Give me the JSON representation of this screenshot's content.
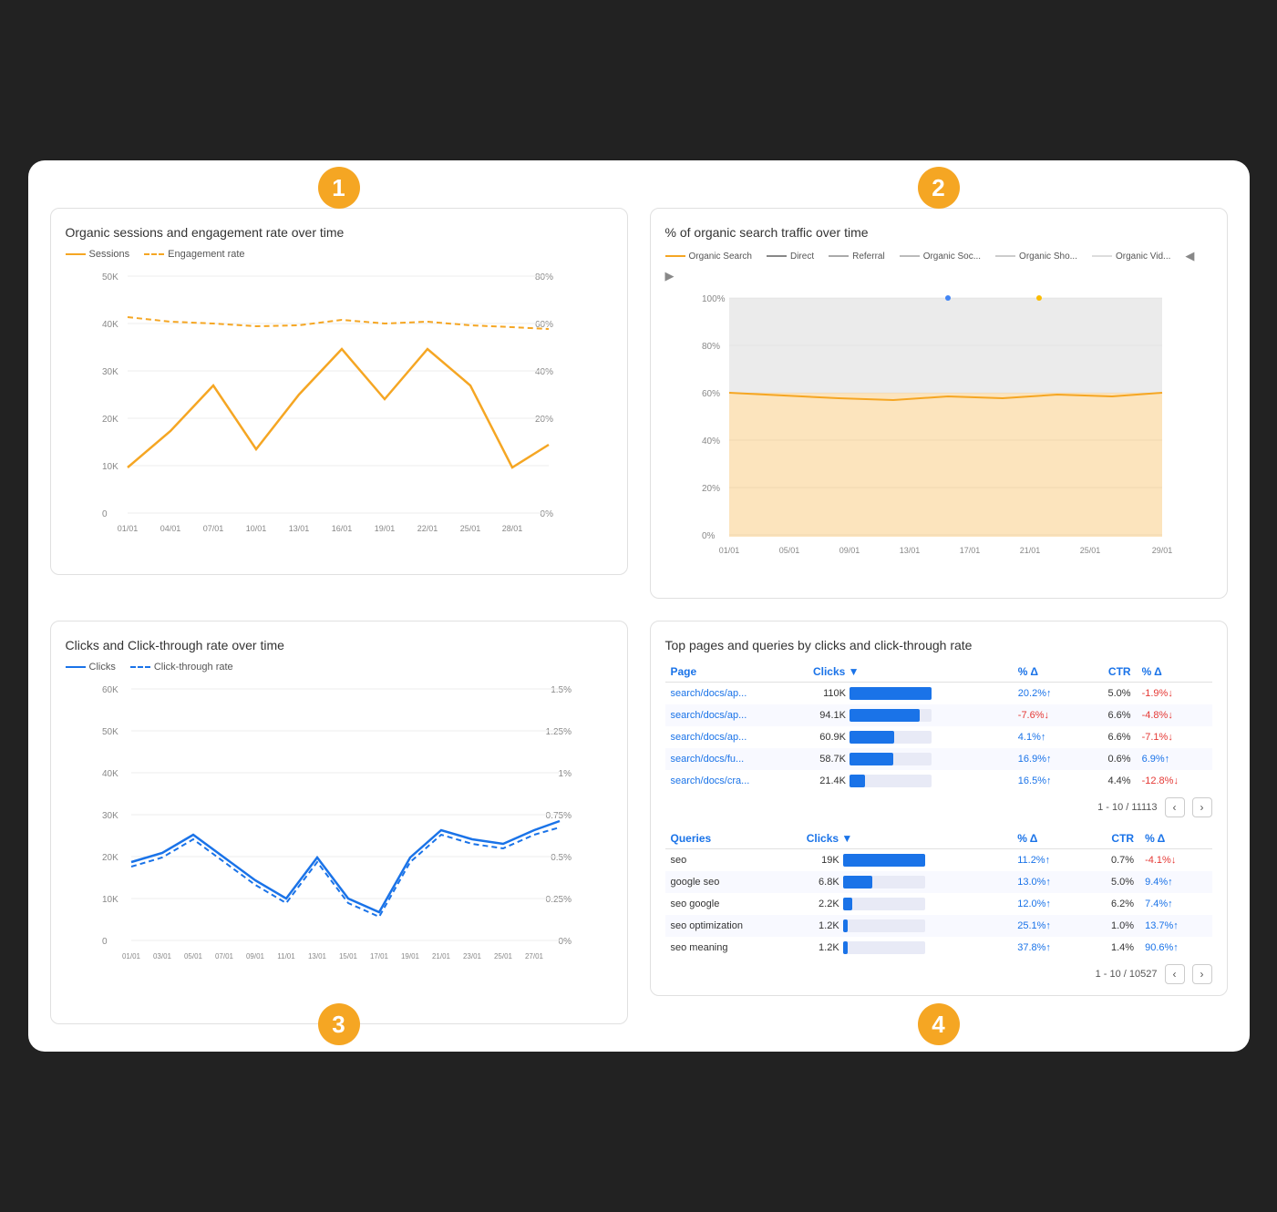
{
  "badges": {
    "one": "1",
    "two": "2",
    "three": "3",
    "four": "4"
  },
  "panel1": {
    "title": "Organic sessions and engagement rate over time",
    "legend": [
      {
        "label": "Sessions",
        "type": "solid",
        "color": "#f5a623"
      },
      {
        "label": "Engagement rate",
        "type": "dashed",
        "color": "#f5a623"
      }
    ],
    "yLabels": [
      "50K",
      "40K",
      "30K",
      "20K",
      "10K",
      "0"
    ],
    "yLabels2": [
      "80%",
      "60%",
      "40%",
      "20%",
      "0%"
    ],
    "xLabels": [
      "01/01",
      "04/01",
      "07/01",
      "10/01",
      "13/01",
      "16/01",
      "19/01",
      "22/01",
      "25/01",
      "28/01"
    ]
  },
  "panel2": {
    "title": "% of organic search traffic over time",
    "legend": [
      {
        "label": "Organic Search",
        "color": "#f5a623"
      },
      {
        "label": "Direct",
        "color": "#888"
      },
      {
        "label": "Referral",
        "color": "#aaa"
      },
      {
        "label": "Organic Soc...",
        "color": "#bbb"
      },
      {
        "label": "Organic Sho...",
        "color": "#ccc"
      },
      {
        "label": "Organic Vid...",
        "color": "#ddd"
      }
    ],
    "xLabels": [
      "01/01",
      "05/01",
      "09/01",
      "13/01",
      "17/01",
      "21/01",
      "25/01",
      "29/01"
    ],
    "yLabels": [
      "100%",
      "80%",
      "60%",
      "40%",
      "20%",
      "0%"
    ]
  },
  "panel3": {
    "title": "Clicks and Click-through rate over time",
    "legend": [
      {
        "label": "Clicks",
        "type": "solid",
        "color": "#1a73e8"
      },
      {
        "label": "Click-through rate",
        "type": "dashed",
        "color": "#1a73e8"
      }
    ],
    "yLabels": [
      "60K",
      "50K",
      "40K",
      "30K",
      "20K",
      "10K",
      "0"
    ],
    "yLabels2": [
      "1.5%",
      "1.25%",
      "1%",
      "0.75%",
      "0.5%",
      "0.25%",
      "0%"
    ],
    "xLabels": [
      "01/01",
      "03/01",
      "05/01",
      "07/01",
      "09/01",
      "11/01",
      "13/01",
      "15/01",
      "17/01",
      "19/01",
      "21/01",
      "23/01",
      "25/01",
      "27/01"
    ]
  },
  "panel4": {
    "title": "Top pages and queries by clicks and click-through rate",
    "pages_header": [
      "Page",
      "Clicks ▼",
      "% Δ",
      "CTR",
      "% Δ"
    ],
    "pages": [
      {
        "page": "search/docs/ap...",
        "clicks": "110K",
        "bar": 100,
        "pct_delta": "20.2%",
        "pct_up": true,
        "ctr": "5.0%",
        "ctr_delta": "-1.9%",
        "ctr_up": false
      },
      {
        "page": "search/docs/ap...",
        "clicks": "94.1K",
        "bar": 86,
        "pct_delta": "-7.6%",
        "pct_up": false,
        "ctr": "6.6%",
        "ctr_delta": "-4.8%",
        "ctr_up": false
      },
      {
        "page": "search/docs/ap...",
        "clicks": "60.9K",
        "bar": 55,
        "pct_delta": "4.1%",
        "pct_up": true,
        "ctr": "6.6%",
        "ctr_delta": "-7.1%",
        "ctr_up": false
      },
      {
        "page": "search/docs/fu...",
        "clicks": "58.7K",
        "bar": 53,
        "pct_delta": "16.9%",
        "pct_up": true,
        "ctr": "0.6%",
        "ctr_delta": "6.9%",
        "ctr_up": true
      },
      {
        "page": "search/docs/cra...",
        "clicks": "21.4K",
        "bar": 19,
        "pct_delta": "16.5%",
        "pct_up": true,
        "ctr": "4.4%",
        "ctr_delta": "-12.8%",
        "ctr_up": false
      }
    ],
    "pages_pagination": "1 - 10 / 11113",
    "queries_header": [
      "Queries",
      "Clicks ▼",
      "% Δ",
      "CTR",
      "% Δ"
    ],
    "queries": [
      {
        "query": "seo",
        "clicks": "19K",
        "bar": 100,
        "pct_delta": "11.2%",
        "pct_up": true,
        "ctr": "0.7%",
        "ctr_delta": "-4.1%",
        "ctr_up": false
      },
      {
        "query": "google seo",
        "clicks": "6.8K",
        "bar": 36,
        "pct_delta": "13.0%",
        "pct_up": true,
        "ctr": "5.0%",
        "ctr_delta": "9.4%",
        "ctr_up": true
      },
      {
        "query": "seo google",
        "clicks": "2.2K",
        "bar": 12,
        "pct_delta": "12.0%",
        "pct_up": true,
        "ctr": "6.2%",
        "ctr_delta": "7.4%",
        "ctr_up": true
      },
      {
        "query": "seo optimization",
        "clicks": "1.2K",
        "bar": 6,
        "pct_delta": "25.1%",
        "pct_up": true,
        "ctr": "1.0%",
        "ctr_delta": "13.7%",
        "ctr_up": true
      },
      {
        "query": "seo meaning",
        "clicks": "1.2K",
        "bar": 6,
        "pct_delta": "37.8%",
        "pct_up": true,
        "ctr": "1.4%",
        "ctr_delta": "90.6%",
        "ctr_up": true
      }
    ],
    "queries_pagination": "1 - 10 / 10527"
  }
}
